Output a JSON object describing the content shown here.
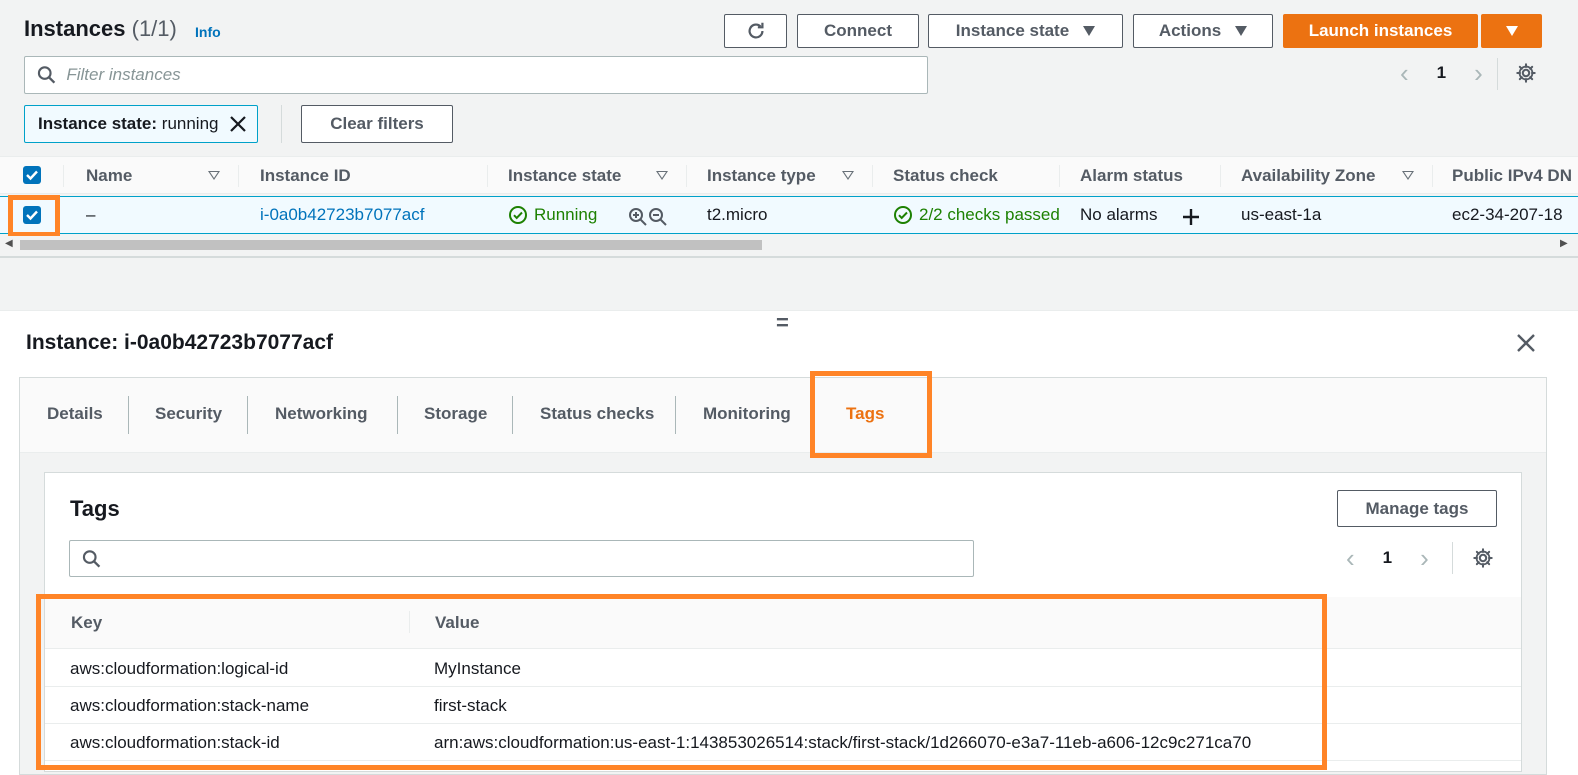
{
  "header": {
    "title": "Instances",
    "count": "(1/1)",
    "info": "Info"
  },
  "toolbar": {
    "connect": "Connect",
    "instance_state": "Instance state",
    "actions": "Actions",
    "launch": "Launch instances"
  },
  "filter": {
    "placeholder": "Filter instances",
    "token_key": "Instance state:",
    "token_value": "running",
    "clear": "Clear filters"
  },
  "pagination": {
    "page": "1"
  },
  "table": {
    "columns": [
      "Name",
      "Instance ID",
      "Instance state",
      "Instance type",
      "Status check",
      "Alarm status",
      "Availability Zone",
      "Public IPv4 DN"
    ],
    "row": {
      "name": "–",
      "instance_id": "i-0a0b42723b7077acf",
      "state": "Running",
      "type": "t2.micro",
      "status_check": "2/2 checks passed",
      "alarm": "No alarms",
      "az": "us-east-1a",
      "public_dns": "ec2-34-207-18"
    }
  },
  "details": {
    "grabber": "=",
    "title": "Instance: i-0a0b42723b7077acf",
    "tabs": [
      "Details",
      "Security",
      "Networking",
      "Storage",
      "Status checks",
      "Monitoring",
      "Tags"
    ],
    "active_tab": "Tags"
  },
  "tags": {
    "title": "Tags",
    "manage": "Manage tags",
    "search_placeholder": "",
    "page": "1",
    "columns": {
      "key": "Key",
      "value": "Value"
    },
    "rows": [
      {
        "key": "aws:cloudformation:logical-id",
        "value": "MyInstance"
      },
      {
        "key": "aws:cloudformation:stack-name",
        "value": "first-stack"
      },
      {
        "key": "aws:cloudformation:stack-id",
        "value": "arn:aws:cloudformation:us-east-1:143853026514:stack/first-stack/1d266070-e3a7-11eb-a606-12c9c271ca70"
      }
    ]
  },
  "colors": {
    "primary": "#ec7211",
    "link": "#0073bb",
    "success": "#1d8102",
    "highlight": "#ff8427"
  }
}
